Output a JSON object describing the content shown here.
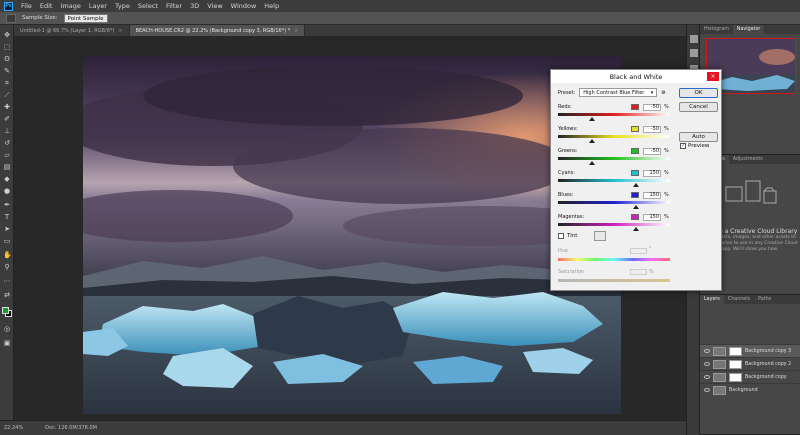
{
  "menubar": {
    "logo": "Ps",
    "items": [
      "File",
      "Edit",
      "Image",
      "Layer",
      "Type",
      "Select",
      "Filter",
      "3D",
      "View",
      "Window",
      "Help"
    ]
  },
  "options": {
    "sample_size_label": "Sample Size:",
    "sample_size_value": "Point Sample"
  },
  "doc_tabs": [
    {
      "label": "Untitled-1 @ 66.7% (Layer 1, RGB/8*)",
      "close": "×"
    },
    {
      "label": "BEACH-HOUSE.CR2 @ 22.2% (Background copy 3, RGB/16*) *",
      "close": "×"
    }
  ],
  "status": {
    "zoom": "22.24%",
    "doc": "Doc: 126.0M/378.0M"
  },
  "panels": {
    "top_tabs": [
      "Histogram",
      "Navigator"
    ],
    "mid_tabs": [
      "Libraries",
      "Adjustments"
    ],
    "library_title": "Create a Creative Cloud Library",
    "library_text": "Save colors, images, and other assets to your libraries to use in any Creative Cloud app. We'll show you how.",
    "layer_tabs": [
      "Layers",
      "Channels",
      "Paths"
    ],
    "layers": [
      {
        "name": "Background copy 3",
        "selected": true
      },
      {
        "name": "Background copy 2",
        "selected": false
      },
      {
        "name": "Background copy",
        "selected": false
      },
      {
        "name": "Background",
        "selected": false
      }
    ]
  },
  "dialog": {
    "title": "Black and White",
    "close": "×",
    "preset_label": "Preset:",
    "preset_value": "High Contrast Blue Filter",
    "buttons": {
      "ok": "OK",
      "cancel": "Cancel",
      "auto": "Auto"
    },
    "preview_label": "Preview",
    "preview_checked": true,
    "percent_sign": "%",
    "sliders": [
      {
        "label": "Reds:",
        "value": "-50",
        "fraction": 0.3,
        "color": "#e02020"
      },
      {
        "label": "Yellows:",
        "value": "-50",
        "fraction": 0.3,
        "color": "#e8e020"
      },
      {
        "label": "Greens:",
        "value": "-50",
        "fraction": 0.3,
        "color": "#20c020"
      },
      {
        "label": "Cyans:",
        "value": "150",
        "fraction": 0.7,
        "color": "#20c0d0"
      },
      {
        "label": "Blues:",
        "value": "150",
        "fraction": 0.7,
        "color": "#2020d0"
      },
      {
        "label": "Magentas:",
        "value": "150",
        "fraction": 0.7,
        "color": "#d020c0"
      }
    ],
    "tint_label": "Tint",
    "hue_label": "Hue",
    "saturation_label": "Saturation",
    "degree_sign": "°"
  }
}
